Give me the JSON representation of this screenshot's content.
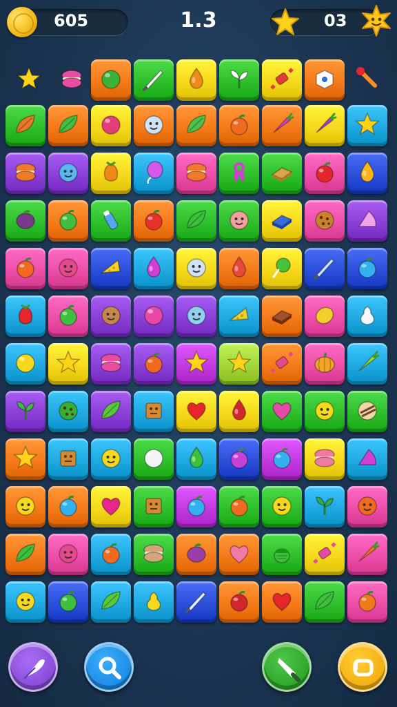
{
  "hud": {
    "coins": "605",
    "level": "1.3",
    "stars": "03",
    "coin_icon": "coin-icon",
    "star_icon": "star-badge-icon",
    "sun_icon": "smiling-star-icon"
  },
  "board": {
    "colors": {
      "G": "#2fbf2c",
      "O": "#f57a1a",
      "Y": "#f6d81c",
      "C": "#20a8e0",
      "P": "#ec4ea8",
      "V": "#8a3fd6",
      "R": "#2b4fd8",
      "L": "#a3d638",
      "M": "#c23be0"
    },
    "loose_top": [
      {
        "icon": "star",
        "fill": "#ffd21a"
      },
      {
        "icon": "macaron",
        "fill": "#e84da1"
      }
    ],
    "top_row": [
      {
        "color": "O",
        "icon": "round",
        "fill": "#3bb23a"
      },
      {
        "color": "G",
        "icon": "knife",
        "fill": "#ffffff"
      },
      {
        "color": "Y",
        "icon": "drop",
        "fill": "#f08a17"
      },
      {
        "color": "G",
        "icon": "sprout",
        "fill": "#ffffff"
      },
      {
        "color": "Y",
        "icon": "candy",
        "fill": "#e33a3a"
      },
      {
        "color": "O",
        "icon": "sugar",
        "fill": "#ffffff"
      }
    ],
    "loose_right": {
      "icon": "wand",
      "fill": "#f58f2c"
    },
    "rows": [
      [
        [
          "G",
          "leaf",
          "#e8782a"
        ],
        [
          "O",
          "leaf",
          "#3fbf3f"
        ],
        [
          "Y",
          "round",
          "#e23f7a"
        ],
        [
          "O",
          "face",
          "#cfe4f7"
        ],
        [
          "O",
          "leaf",
          "#4ec24a"
        ],
        [
          "O",
          "apple",
          "#f06a22"
        ],
        [
          "O",
          "carrot",
          "#d23fd6"
        ],
        [
          "Y",
          "carrot",
          "#a23fd6"
        ],
        [
          "C",
          "star",
          "#ffd21a"
        ]
      ],
      [
        [
          "V",
          "macaron",
          "#f07a2a"
        ],
        [
          "V",
          "face",
          "#5ab6f2"
        ],
        [
          "Y",
          "pine",
          "#f08a17"
        ],
        [
          "C",
          "balloon",
          "#d35ae8"
        ],
        [
          "P",
          "macaron",
          "#f07a2a"
        ],
        [
          "G",
          "bow",
          "#d03fd0"
        ],
        [
          "G",
          "cake",
          "#d9a44a"
        ],
        [
          "P",
          "apple",
          "#e3262c"
        ],
        [
          "R",
          "drop",
          "#ffb31a"
        ]
      ],
      [
        [
          "G",
          "plum",
          "#7a3a8a"
        ],
        [
          "O",
          "apple",
          "#3fbf3f"
        ],
        [
          "G",
          "bottle",
          "#56a6f2"
        ],
        [
          "O",
          "apple",
          "#e8322c"
        ],
        [
          "G",
          "leaf",
          "#3fbf3f"
        ],
        [
          "G",
          "face",
          "#f4a09a"
        ],
        [
          "Y",
          "cake",
          "#3b6ad8"
        ],
        [
          "P",
          "cookie",
          "#c9832a"
        ],
        [
          "V",
          "slice",
          "#f2a6e8"
        ]
      ],
      [
        [
          "P",
          "apple",
          "#f06a22"
        ],
        [
          "P",
          "face",
          "#e44a8a"
        ],
        [
          "R",
          "cheese",
          "#ffd21a"
        ],
        [
          "C",
          "drop",
          "#d33fd3"
        ],
        [
          "Y",
          "face",
          "#cfe4f7"
        ],
        [
          "O",
          "drop",
          "#e6483a"
        ],
        [
          "Y",
          "lolly",
          "#49c23a"
        ],
        [
          "R",
          "knife",
          "#cfe8ff"
        ],
        [
          "R",
          "apple",
          "#35b0ef"
        ]
      ],
      [
        [
          "C",
          "pine",
          "#e5262c"
        ],
        [
          "P",
          "apple",
          "#3fbf3f"
        ],
        [
          "V",
          "face",
          "#c8874a"
        ],
        [
          "V",
          "round",
          "#e54aa8"
        ],
        [
          "V",
          "face",
          "#8ed2f0"
        ],
        [
          "C",
          "cheese",
          "#f2cf2a"
        ],
        [
          "O",
          "cake",
          "#a0502a"
        ],
        [
          "P",
          "lemon",
          "#f2cf2a"
        ],
        [
          "C",
          "pear",
          "#f4f7fb"
        ]
      ],
      [
        [
          "C",
          "round",
          "#f6d81c"
        ],
        [
          "Y",
          "star",
          "#ffd21a"
        ],
        [
          "V",
          "macaron",
          "#e84da1"
        ],
        [
          "V",
          "apple",
          "#f06a22"
        ],
        [
          "M",
          "star",
          "#ffd21a"
        ],
        [
          "L",
          "star",
          "#ffd21a"
        ],
        [
          "O",
          "candy",
          "#e44a8a"
        ],
        [
          "P",
          "pumpkin",
          "#f2a624"
        ],
        [
          "C",
          "carrot",
          "#9bd63a"
        ]
      ],
      [
        [
          "V",
          "sprout",
          "#3fbf3f"
        ],
        [
          "C",
          "cookie",
          "#35b035"
        ],
        [
          "V",
          "leaf",
          "#58c93a"
        ],
        [
          "C",
          "box",
          "#d28a34"
        ],
        [
          "Y",
          "heart",
          "#e5262c"
        ],
        [
          "Y",
          "drop",
          "#d2262c"
        ],
        [
          "G",
          "heart",
          "#e54aa8"
        ],
        [
          "G",
          "face",
          "#f6d81c"
        ],
        [
          "G",
          "donut",
          "#6a4a2a"
        ]
      ],
      [
        [
          "O",
          "star",
          "#ffd21a"
        ],
        [
          "C",
          "box",
          "#d28a34"
        ],
        [
          "C",
          "face",
          "#f6d81c"
        ],
        [
          "G",
          "round",
          "#f3f3f3"
        ],
        [
          "C",
          "drop",
          "#3fbf3f"
        ],
        [
          "R",
          "apple",
          "#c63fd6"
        ],
        [
          "M",
          "apple",
          "#35b0ef"
        ],
        [
          "Y",
          "macaron",
          "#f07aa2"
        ],
        [
          "C",
          "slice",
          "#d33fd3"
        ]
      ],
      [
        [
          "O",
          "face",
          "#f6d81c"
        ],
        [
          "O",
          "apple",
          "#35b0ef"
        ],
        [
          "Y",
          "heart",
          "#e5268a"
        ],
        [
          "G",
          "box",
          "#d28a34"
        ],
        [
          "M",
          "apple",
          "#35b0ef"
        ],
        [
          "G",
          "apple",
          "#f06a22"
        ],
        [
          "G",
          "face",
          "#f6d81c"
        ],
        [
          "C",
          "sprout",
          "#2fae4a"
        ],
        [
          "P",
          "face",
          "#f06a22"
        ]
      ],
      [
        [
          "O",
          "leaf",
          "#3fbf3f"
        ],
        [
          "P",
          "face",
          "#e44a8a"
        ],
        [
          "C",
          "apple",
          "#f06a22"
        ],
        [
          "G",
          "macaron",
          "#d2a67a"
        ],
        [
          "O",
          "plum",
          "#9a3fa8"
        ],
        [
          "O",
          "heart",
          "#f27aa8"
        ],
        [
          "G",
          "acorn",
          "#3fbf3f"
        ],
        [
          "Y",
          "candy",
          "#e54aa8"
        ],
        [
          "P",
          "carrot",
          "#f07a1a"
        ]
      ],
      [
        [
          "C",
          "face",
          "#f6d81c"
        ],
        [
          "R",
          "apple",
          "#3fbf3f"
        ],
        [
          "C",
          "leaf",
          "#58c93a"
        ],
        [
          "C",
          "pear",
          "#f6d81c"
        ],
        [
          "R",
          "knife",
          "#e8f4ff"
        ],
        [
          "O",
          "apple",
          "#d2262c"
        ],
        [
          "O",
          "heart",
          "#e5262c"
        ],
        [
          "G",
          "leaf",
          "#3fbf3f"
        ],
        [
          "P",
          "apple",
          "#f07a1a"
        ]
      ]
    ]
  },
  "footer": {
    "buttons": [
      {
        "name": "shuffle-button",
        "icon": "feather-icon",
        "color": "#8a4fd8"
      },
      {
        "name": "search-button",
        "icon": "magnifier-icon",
        "color": "#1e8ee6"
      },
      {
        "name": "remove-button",
        "icon": "knife-icon",
        "color": "#2fa82c"
      },
      {
        "name": "undo-button",
        "icon": "undo-icon",
        "color": "#f5b014"
      }
    ]
  }
}
